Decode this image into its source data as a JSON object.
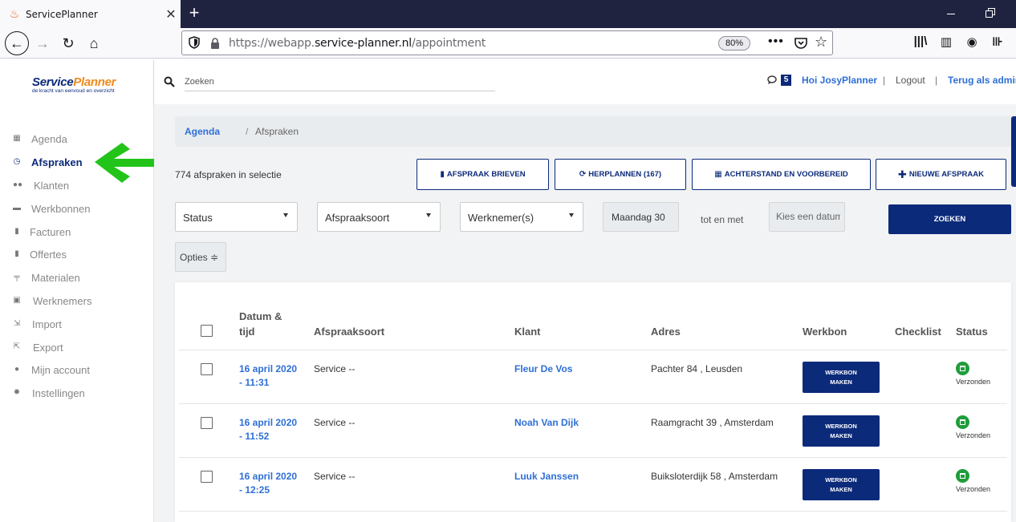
{
  "browser": {
    "tab_title": "ServicePlanner",
    "url_prefix": "https://webapp.",
    "url_domain": "service-planner.nl",
    "url_path": "/appointment",
    "zoom": "80%"
  },
  "logo": {
    "service": "Service",
    "planner": "Planner",
    "tagline": "de kracht van eenvoud en overzicht"
  },
  "sidebar": {
    "items": [
      {
        "label": "Agenda",
        "icon": "calendar-icon"
      },
      {
        "label": "Afspraken",
        "icon": "clock-icon",
        "active": true
      },
      {
        "label": "Klanten",
        "icon": "users-icon"
      },
      {
        "label": "Werkbonnen",
        "icon": "briefcase-icon"
      },
      {
        "label": "Facturen",
        "icon": "file-icon"
      },
      {
        "label": "Offertes",
        "icon": "file-icon"
      },
      {
        "label": "Materialen",
        "icon": "paint-roller-icon"
      },
      {
        "label": "Werknemers",
        "icon": "id-badge-icon"
      },
      {
        "label": "Import",
        "icon": "import-icon"
      },
      {
        "label": "Export",
        "icon": "export-icon"
      },
      {
        "label": "Mijn account",
        "icon": "user-icon"
      },
      {
        "label": "Instellingen",
        "icon": "gear-icon"
      }
    ]
  },
  "topbar": {
    "search_placeholder": "Zoeken",
    "message_count": "5",
    "greeting": "Hoi JosyPlanner",
    "separator": "|",
    "logout": "Logout",
    "back_admin": "Terug als admin"
  },
  "breadcrumb": {
    "home": "Agenda",
    "separator": "/",
    "current": "Afspraken"
  },
  "selection_count": "774 afspraken in selectie",
  "actions": {
    "brieven": "AFSPRAAK BRIEVEN",
    "herplannen": "HERPLANNEN (167)",
    "achterstand": "ACHTERSTAND EN VOORBEREID",
    "nieuwe": "NIEUWE AFSPRAAK"
  },
  "filters": {
    "status": "Status",
    "afspraaksoort": "Afspraaksoort",
    "werknemers": "Werknemer(s)",
    "date_from": "Maandag 30",
    "tot_en_met": "tot en met",
    "date_to_placeholder": "Kies een datum",
    "zoeken": "ZOEKEN",
    "opties": "Opties ≑"
  },
  "table": {
    "headers": {
      "datum_line1": "Datum &",
      "datum_line2": "tijd",
      "afspraaksoort": "Afspraaksoort",
      "klant": "Klant",
      "adres": "Adres",
      "werkbon": "Werkbon",
      "checklist": "Checklist",
      "status": "Status"
    },
    "rows": [
      {
        "date": "16 april 2020",
        "time": "- 11:31",
        "soort": "Service --",
        "klant": "Fleur De Vos",
        "adres": "Pachter 84 , Leusden",
        "werkbon_l1": "WERKBON",
        "werkbon_l2": "MAKEN",
        "status": "Verzonden"
      },
      {
        "date": "16 april 2020",
        "time": "- 11:52",
        "soort": "Service --",
        "klant": "Noah Van Dijk",
        "adres": "Raamgracht 39 , Amsterdam",
        "werkbon_l1": "WERKBON",
        "werkbon_l2": "MAKEN",
        "status": "Verzonden"
      },
      {
        "date": "16 april 2020",
        "time": "- 12:25",
        "soort": "Service --",
        "klant": "Luuk Janssen",
        "adres": "Buiksloterdijk 58 , Amsterdam",
        "werkbon_l1": "WERKBON",
        "werkbon_l2": "MAKEN",
        "status": "Verzonden"
      }
    ]
  },
  "colors": {
    "brand_navy": "#0b2a7a",
    "link_blue": "#2f6fd6",
    "logo_orange": "#f08a1c",
    "status_green": "#1f9d3c",
    "arrow_green": "#22c41a"
  }
}
